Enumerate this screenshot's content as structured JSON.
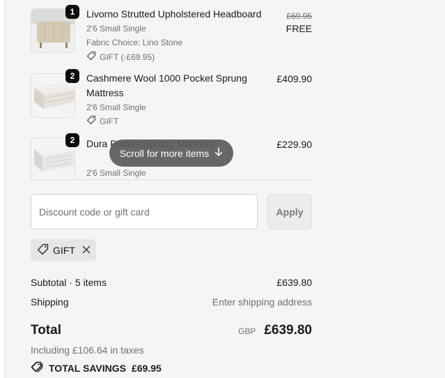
{
  "items": [
    {
      "quantity": "1",
      "title": "Livorno Strutted Upholstered Headboard",
      "size": "2'6 Small Single",
      "option": "Fabric Choice: Lino Stone",
      "gift": "GIFT (-£69.95)",
      "original_price": "£69.95",
      "price": "FREE"
    },
    {
      "quantity": "2",
      "title": "Cashmere Wool 1000 Pocket Sprung Mattress",
      "size": "2'6 Small Single",
      "gift": "GIFT",
      "price": "£409.90"
    },
    {
      "quantity": "2",
      "title": "Dura Pocket Sprung Mattress",
      "size": "2'6 Small Single",
      "price": "£229.90"
    }
  ],
  "scroll_hint": "Scroll for more items",
  "discount": {
    "placeholder": "Discount code or gift card",
    "apply_label": "Apply"
  },
  "applied_code": "GIFT",
  "summary": {
    "subtotal_label": "Subtotal · 5 items",
    "subtotal_value": "£639.80",
    "shipping_label": "Shipping",
    "shipping_value": "Enter shipping address",
    "total_label": "Total",
    "currency": "GBP",
    "total_value": "£639.80",
    "taxes_note": "Including £106.64 in taxes",
    "savings_label": "TOTAL SAVINGS",
    "savings_value": "£69.95"
  },
  "icons": [
    "tag-icon",
    "arrow-down-icon",
    "close-icon"
  ],
  "colors": {
    "background": "#f5f5f5",
    "badge": "#0d0d0d",
    "pill": "#5a5a5a"
  }
}
